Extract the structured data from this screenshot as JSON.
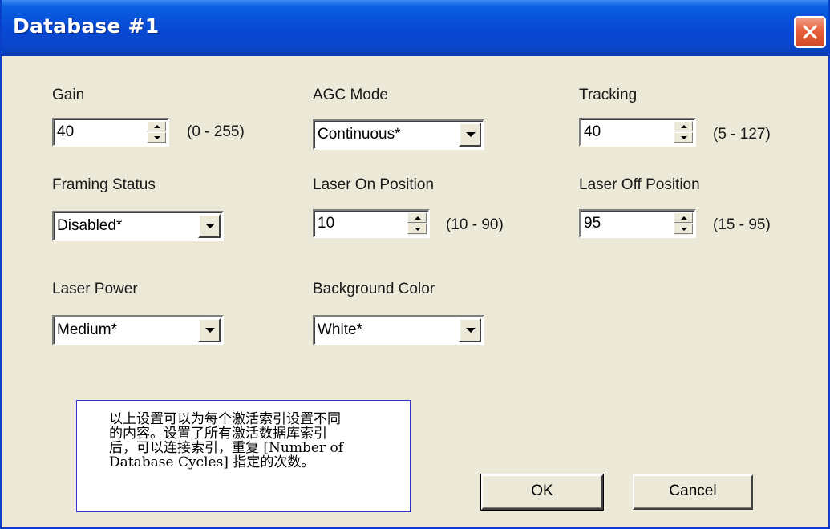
{
  "window": {
    "title": "Database #1",
    "close_icon": "close-icon"
  },
  "fields": {
    "gain": {
      "label": "Gain",
      "value": "40",
      "range": "(0 - 255)"
    },
    "agc_mode": {
      "label": "AGC Mode",
      "value": "Continuous*"
    },
    "tracking": {
      "label": "Tracking",
      "value": "40",
      "range": "(5 - 127)"
    },
    "framing_status": {
      "label": "Framing Status",
      "value": "Disabled*"
    },
    "laser_on_position": {
      "label": "Laser On Position",
      "value": "10",
      "range": "(10 - 90)"
    },
    "laser_off_position": {
      "label": "Laser Off Position",
      "value": "95",
      "range": "(15 - 95)"
    },
    "laser_power": {
      "label": "Laser Power",
      "value": "Medium*"
    },
    "background_color": {
      "label": "Background Color",
      "value": "White*"
    }
  },
  "note": {
    "text": "以上设置可以为每个激活索引设置不同的内容。设置了所有激活数据库索引后，可以连接索引，重复 [Number of Database Cycles] 指定的次数。"
  },
  "buttons": {
    "ok": "OK",
    "cancel": "Cancel"
  },
  "colors": {
    "titlebar": "#0848d4",
    "dialog_bg": "#ece9d8",
    "close_button": "#e6613c",
    "note_border": "#3333cc"
  }
}
